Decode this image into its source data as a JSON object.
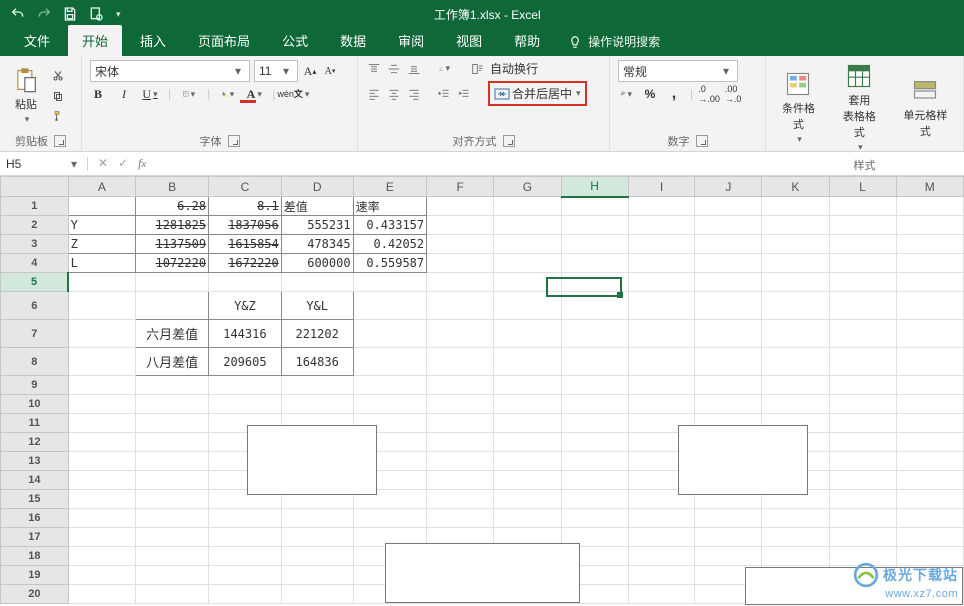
{
  "app": {
    "title": "工作簿1.xlsx  -  Excel"
  },
  "tabs": {
    "file": "文件",
    "home": "开始",
    "insert": "插入",
    "layout": "页面布局",
    "formulas": "公式",
    "data": "数据",
    "review": "审阅",
    "view": "视图",
    "help": "帮助",
    "search": "操作说明搜索"
  },
  "ribbon": {
    "clipboard": {
      "paste": "粘贴",
      "label": "剪贴板"
    },
    "font": {
      "name": "宋体",
      "size": "11",
      "label": "字体"
    },
    "align": {
      "wrap": "自动换行",
      "merge": "合并后居中",
      "label": "对齐方式"
    },
    "number": {
      "format": "常规",
      "label": "数字"
    },
    "styles": {
      "cond": "条件格式",
      "table": "套用\n表格格式",
      "cell": "单元格样式",
      "label": "样式"
    }
  },
  "namebox": "H5",
  "columns": [
    "A",
    "B",
    "C",
    "D",
    "E",
    "F",
    "G",
    "H",
    "I",
    "J",
    "K",
    "L",
    "M"
  ],
  "rows": [
    "1",
    "2",
    "3",
    "4",
    "5",
    "6",
    "7",
    "8",
    "9",
    "10",
    "11",
    "12",
    "13",
    "14",
    "15",
    "16",
    "17",
    "18",
    "19",
    "20"
  ],
  "cells": {
    "B1": "6.28",
    "C1": "8.1",
    "D1": "差值",
    "E1": "速率",
    "A2": "Y",
    "B2": "1281825",
    "C2": "1837056",
    "D2": "555231",
    "E2": "0.433157",
    "A3": "Z",
    "B3": "1137509",
    "C3": "1615854",
    "D3": "478345",
    "E3": "0.42052",
    "A4": "L",
    "B4": "1072220",
    "C4": "1672220",
    "D4": "600000",
    "E4": "0.559587",
    "C6": "Y&Z",
    "D6": "Y&L",
    "B7": "六月差值",
    "C7": "144316",
    "D7": "221202",
    "B8": "八月差值",
    "C8": "209605",
    "D8": "164836"
  },
  "watermark": {
    "name": "极光下载站",
    "url": "www.xz7.com"
  },
  "chart_data": {
    "type": "table",
    "tables": [
      {
        "title": "差值/速率",
        "columns": [
          "",
          "6.28",
          "8.1",
          "差值",
          "速率"
        ],
        "rows": [
          [
            "Y",
            1281825,
            1837056,
            555231,
            0.433157
          ],
          [
            "Z",
            1137509,
            1615854,
            478345,
            0.42052
          ],
          [
            "L",
            1072220,
            1672220,
            600000,
            0.559587
          ]
        ]
      },
      {
        "title": "月差值",
        "columns": [
          "",
          "Y&Z",
          "Y&L"
        ],
        "rows": [
          [
            "六月差值",
            144316,
            221202
          ],
          [
            "八月差值",
            209605,
            164836
          ]
        ]
      }
    ]
  }
}
